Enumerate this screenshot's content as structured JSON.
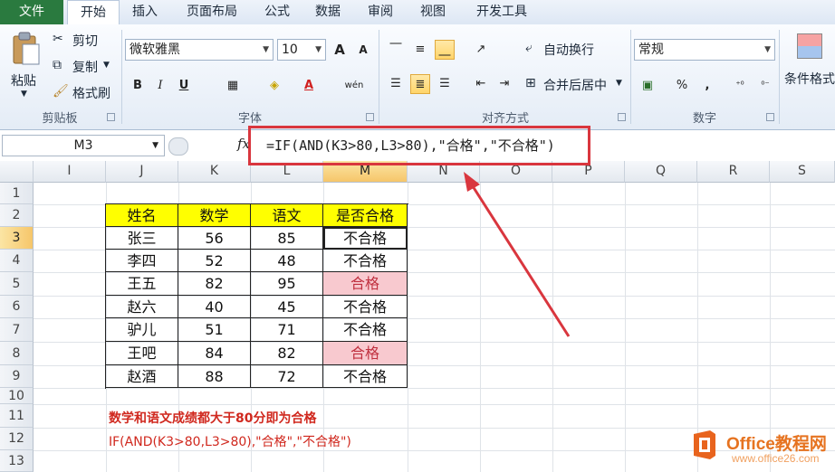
{
  "menu": {
    "tabs": [
      "文件",
      "开始",
      "插入",
      "页面布局",
      "公式",
      "数据",
      "审阅",
      "视图",
      "开发工具"
    ]
  },
  "ribbon": {
    "clipboard": {
      "paste": "粘贴",
      "cut": "剪切",
      "copy": "复制",
      "format_painter": "格式刷",
      "label": "剪贴板"
    },
    "font": {
      "name": "微软雅黑",
      "size": "10",
      "label": "字体",
      "bold": "B",
      "italic": "I",
      "underline": "U",
      "grow": "A",
      "shrink": "A",
      "font_color": "A",
      "phonetic": "wén"
    },
    "alignment": {
      "wrap": "自动换行",
      "merge": "合并后居中",
      "label": "对齐方式"
    },
    "number": {
      "format": "常规",
      "percent": "%",
      "comma": ",",
      "label": "数字"
    },
    "styles": {
      "conditional": "条件格式"
    }
  },
  "formula_bar": {
    "name_box": "M3",
    "fx": "fx",
    "formula": "=IF(AND(K3>80,L3>80),\"合格\",\"不合格\")"
  },
  "columns": [
    "I",
    "J",
    "K",
    "L",
    "M",
    "N",
    "O",
    "P",
    "Q",
    "R",
    "S"
  ],
  "rows": [
    "1",
    "2",
    "3",
    "4",
    "5",
    "6",
    "7",
    "8",
    "9",
    "10",
    "11",
    "12",
    "13"
  ],
  "table": {
    "headers": [
      "姓名",
      "数学",
      "语文",
      "是否合格"
    ],
    "rows": [
      [
        "张三",
        "56",
        "85",
        "不合格"
      ],
      [
        "李四",
        "52",
        "48",
        "不合格"
      ],
      [
        "王五",
        "82",
        "95",
        "合格"
      ],
      [
        "赵六",
        "40",
        "45",
        "不合格"
      ],
      [
        "驴儿",
        "51",
        "71",
        "不合格"
      ],
      [
        "王吧",
        "84",
        "82",
        "合格"
      ],
      [
        "赵酒",
        "88",
        "72",
        "不合格"
      ]
    ]
  },
  "notes": {
    "line1": "数学和语文成绩都大于80分即为合格",
    "line2": "IF(AND(K3>80,L3>80),\"合格\",\"不合格\")"
  },
  "watermark": {
    "title": "Office教程网",
    "url": "www.office26.com"
  },
  "colors": {
    "highlight": "#ffff00",
    "pass_fill": "#f8c9cf",
    "annotation": "#d9363e",
    "file_tab": "#2a7a3f"
  }
}
